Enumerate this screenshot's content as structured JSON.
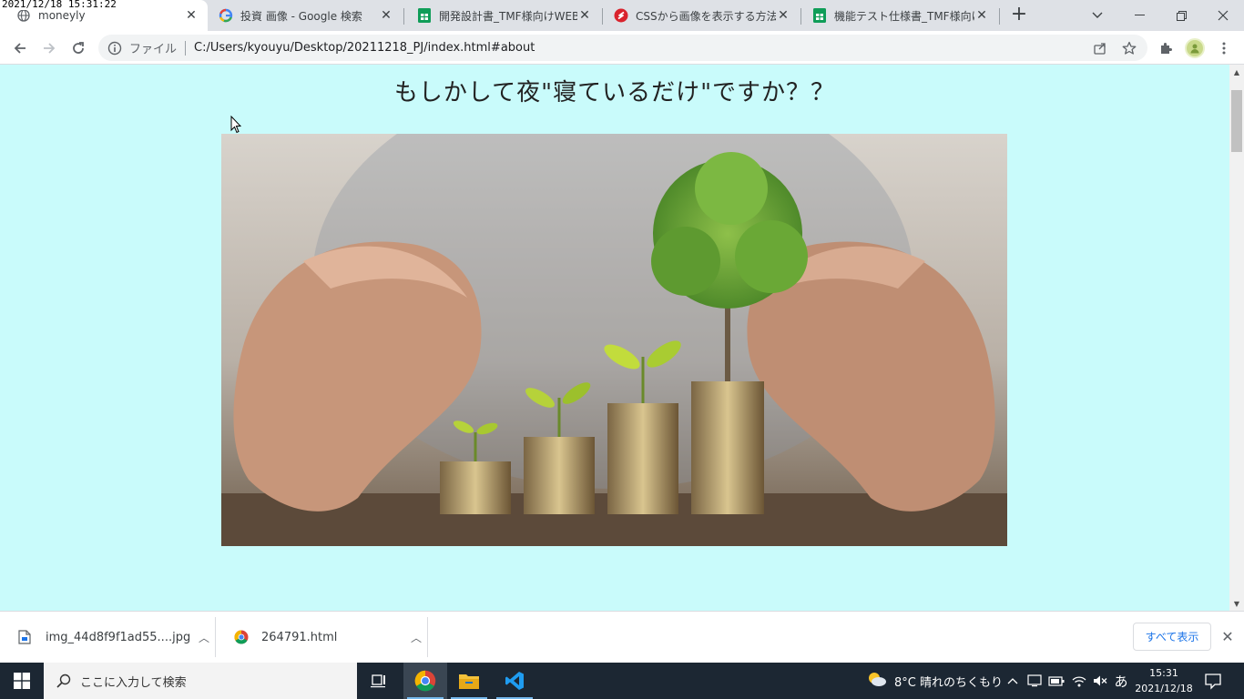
{
  "overlay_timestamp": "2021/12/18 15:31:22",
  "tabs": [
    {
      "title": "moneyly",
      "icon": "globe-icon",
      "active": true
    },
    {
      "title": "投資 画像 - Google 検索",
      "icon": "google-icon",
      "active": false
    },
    {
      "title": "開発設計書_TMF様向けWEBサ",
      "icon": "sheets-icon",
      "active": false
    },
    {
      "title": "CSSから画像を表示する方法と(",
      "icon": "red-s-icon",
      "active": false
    },
    {
      "title": "機能テスト仕様書_TMF様向けW",
      "icon": "sheets-icon",
      "active": false
    }
  ],
  "toolbar": {
    "protocol_label": "ファイル",
    "url": "C:/Users/kyouyu/Desktop/20211218_PJ/index.html#about"
  },
  "page": {
    "heading": "もしかして夜\"寝ているだけ\"ですか？？",
    "hero_image": "hands-protecting-coin-stacks-with-growing-plants"
  },
  "downloads": {
    "items": [
      {
        "name": "img_44d8f9f1ad55....jpg",
        "icon": "file-icon"
      },
      {
        "name": "264791.html",
        "icon": "chrome-icon"
      }
    ],
    "show_all": "すべて表示"
  },
  "taskbar": {
    "search_placeholder": "ここに入力して検索",
    "weather": "8°C 晴れのちくもり",
    "ime": "あ",
    "time": "15:31",
    "date": "2021/12/18"
  }
}
